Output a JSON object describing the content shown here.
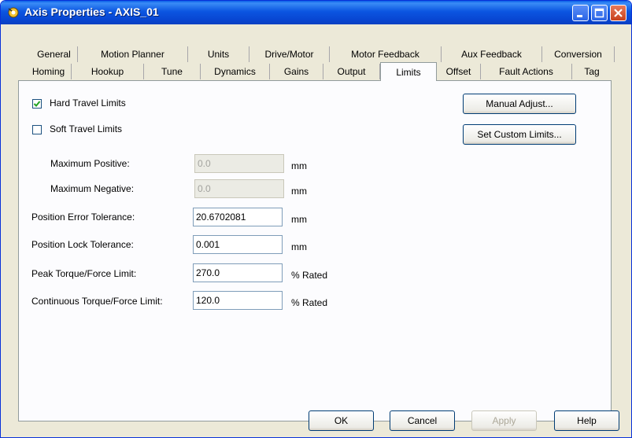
{
  "window": {
    "title": "Axis Properties - AXIS_01"
  },
  "tabs": {
    "row1": [
      "General",
      "Motion Planner",
      "Units",
      "Drive/Motor",
      "Motor Feedback",
      "Aux Feedback",
      "Conversion"
    ],
    "row2": [
      "Homing",
      "Hookup",
      "Tune",
      "Dynamics",
      "Gains",
      "Output",
      "Limits",
      "Offset",
      "Fault Actions",
      "Tag"
    ],
    "selected": "Limits"
  },
  "limits": {
    "hard_travel": {
      "label": "Hard Travel Limits",
      "checked": true
    },
    "soft_travel": {
      "label": "Soft Travel Limits",
      "checked": false
    },
    "manual_adjust": "Manual Adjust...",
    "set_custom_limits": "Set Custom Limits...",
    "max_positive": {
      "label": "Maximum Positive:",
      "value": "0.0",
      "unit": "mm"
    },
    "max_negative": {
      "label": "Maximum Negative:",
      "value": "0.0",
      "unit": "mm"
    },
    "pos_error_tol": {
      "label": "Position Error Tolerance:",
      "value": "20.6702081",
      "unit": "mm"
    },
    "pos_lock_tol": {
      "label": "Position Lock Tolerance:",
      "value": "0.001",
      "unit": "mm"
    },
    "peak_torque": {
      "label": "Peak Torque/Force Limit:",
      "value": "270.0",
      "unit": "% Rated"
    },
    "cont_torque": {
      "label": "Continuous Torque/Force Limit:",
      "value": "120.0",
      "unit": "% Rated"
    }
  },
  "footer": {
    "ok": "OK",
    "cancel": "Cancel",
    "apply": "Apply",
    "help": "Help"
  },
  "colors": {
    "titlebar": "#0846d2",
    "dialog_bg": "#ece9d8",
    "panel_bg": "#fcfcfe"
  },
  "icons": {
    "app": "axis-gear-icon",
    "minimize": "minimize-icon",
    "maximize": "maximize-icon",
    "close": "close-icon",
    "check": "checkmark-icon"
  }
}
